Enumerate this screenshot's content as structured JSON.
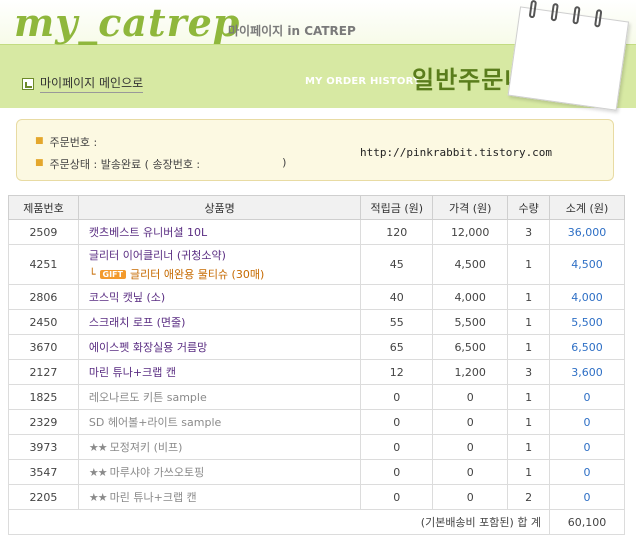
{
  "header": {
    "logo": "my_catrep",
    "logo_sub": "마이페이지 in CATREP",
    "home_link": "마이페이지 메인으로",
    "order_eng": "MY ORDER HISTORY",
    "order_kor": "일반주문내역"
  },
  "info": {
    "order_number_label": "주문번호 :",
    "order_status_label": "주문상태 : 발송완료 ( 송장번호 :",
    "order_status_close": ")",
    "watermark": "http://pinkrabbit.tistory.com"
  },
  "table": {
    "headers": [
      "제품번호",
      "상품명",
      "적립금 (원)",
      "가격 (원)",
      "수량",
      "소계 (원)"
    ],
    "rows": [
      {
        "id": "2509",
        "name": "캣츠베스트 유니버셜 10L",
        "points": "120",
        "price": "12,000",
        "qty": "3",
        "subtotal": "36,000"
      },
      {
        "id": "4251",
        "name": "글리터 이어클리너 (귀청소약)",
        "gift_badge": "GIFT",
        "gift_name": "글리터 애완용 물티슈 (30매)",
        "points": "45",
        "price": "4,500",
        "qty": "1",
        "subtotal": "4,500"
      },
      {
        "id": "2806",
        "name": "코스믹 캣닢 (소)",
        "points": "40",
        "price": "4,000",
        "qty": "1",
        "subtotal": "4,000"
      },
      {
        "id": "2450",
        "name": "스크래치 로프 (면줄)",
        "points": "55",
        "price": "5,500",
        "qty": "1",
        "subtotal": "5,500"
      },
      {
        "id": "3670",
        "name": "에이스펫 화장실용 거름망",
        "points": "65",
        "price": "6,500",
        "qty": "1",
        "subtotal": "6,500"
      },
      {
        "id": "2127",
        "name": "마린 튜나+크랩 캔",
        "points": "12",
        "price": "1,200",
        "qty": "3",
        "subtotal": "3,600"
      },
      {
        "id": "1825",
        "name": "레오나르도 키튼 sample",
        "points": "0",
        "price": "0",
        "qty": "1",
        "subtotal": "0"
      },
      {
        "id": "2329",
        "name": "SD 헤어볼+라이트 sample",
        "points": "0",
        "price": "0",
        "qty": "1",
        "subtotal": "0"
      },
      {
        "id": "3973",
        "stars": "★★",
        "name": "모정져키 (비프)",
        "points": "0",
        "price": "0",
        "qty": "1",
        "subtotal": "0"
      },
      {
        "id": "3547",
        "stars": "★★",
        "name": "마루샤야 가쓰오토핑",
        "points": "0",
        "price": "0",
        "qty": "1",
        "subtotal": "0"
      },
      {
        "id": "2205",
        "stars": "★★",
        "name": "마린 튜나+크랩 캔",
        "points": "0",
        "price": "0",
        "qty": "2",
        "subtotal": "0"
      }
    ],
    "footer_label": "(기본배송비 포함된) 합 계",
    "footer_total": "60,100"
  },
  "colors": {
    "accent_green": "#8fb73c",
    "band_green": "#d7e9a3",
    "title_green": "#5a7d1c",
    "product_purple": "#5a2d82",
    "subtotal_blue": "#2e6fc5",
    "gift_orange": "#c66a00"
  }
}
